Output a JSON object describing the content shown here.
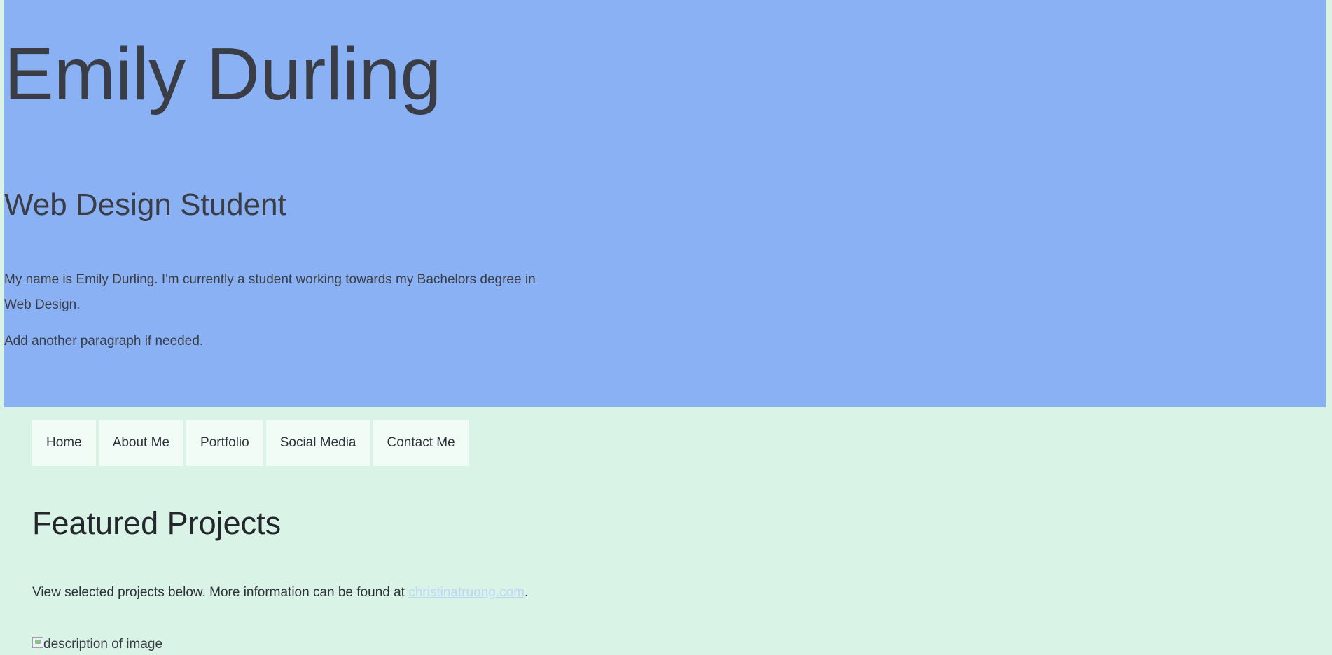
{
  "hero": {
    "title": "Emily Durling",
    "subtitle": "Web Design Student",
    "paragraph1": "My name is Emily Durling. I'm currently a student working towards my Bachelors degree in Web Design.",
    "paragraph2": "Add another paragraph if needed.",
    "background_color": "#8ab1f4"
  },
  "nav": {
    "items": [
      {
        "label": "Home"
      },
      {
        "label": "About Me"
      },
      {
        "label": "Portfolio"
      },
      {
        "label": "Social Media"
      },
      {
        "label": "Contact Me"
      }
    ]
  },
  "featured": {
    "title": "Featured Projects",
    "text_before_link": "View selected projects below. More information can be found at ",
    "link_text": "christinatruong.com",
    "text_after_link": ".",
    "image_alt": "description of image"
  },
  "colors": {
    "page_background": "#d9f3e6",
    "nav_item_background": "#f2fcf7",
    "link": "#bcd6f6"
  }
}
